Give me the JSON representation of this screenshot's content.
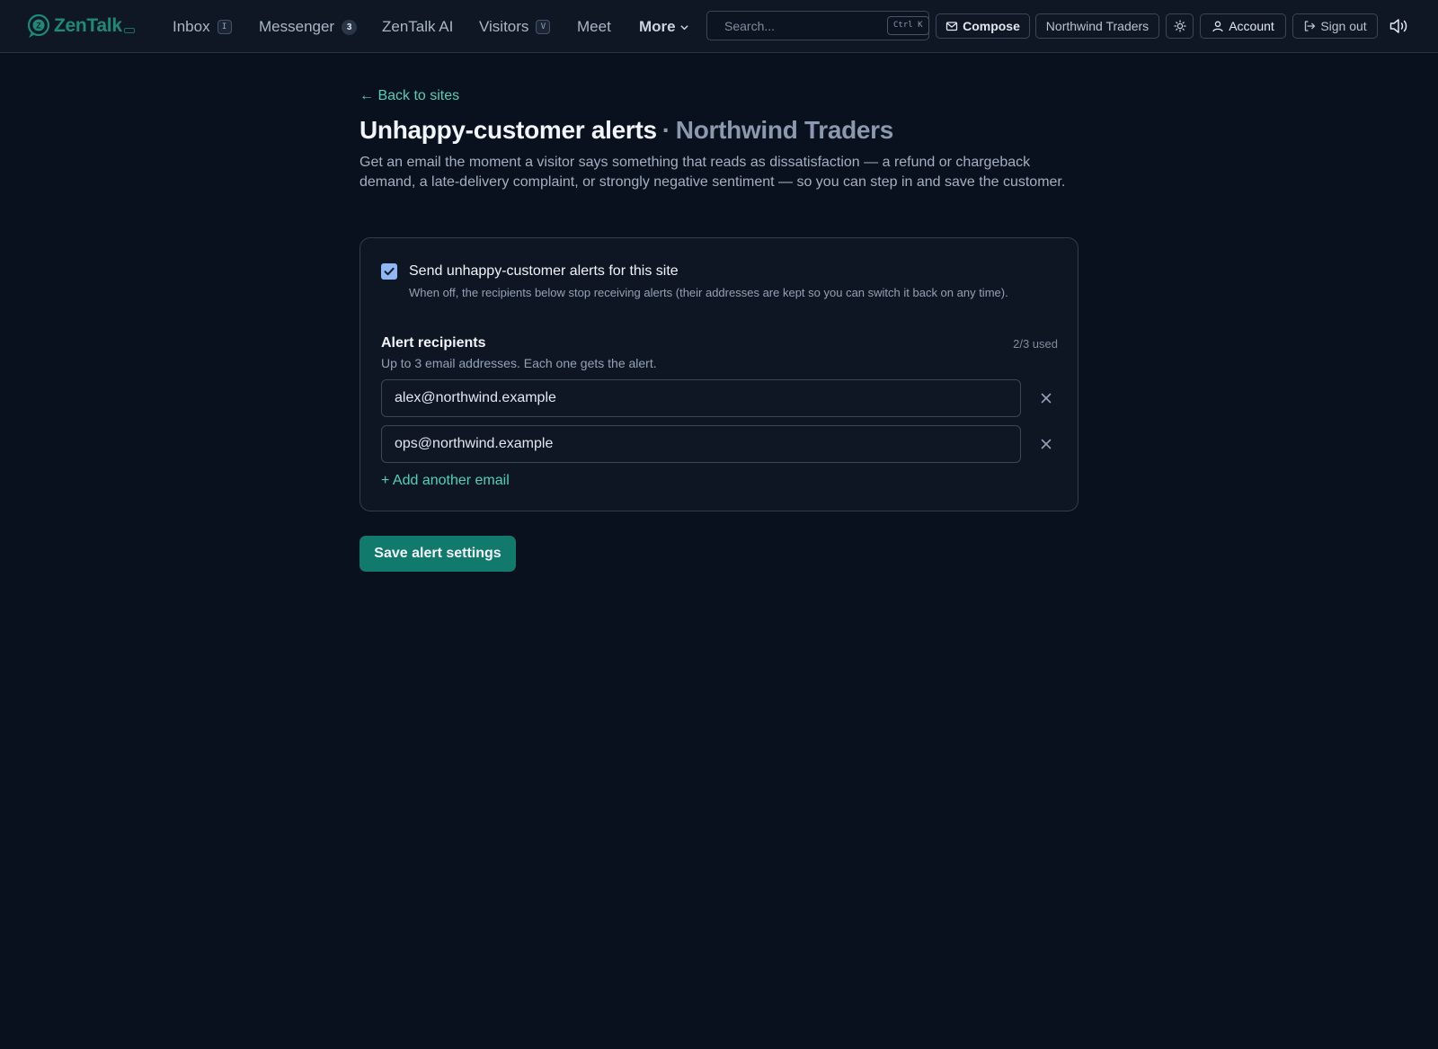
{
  "brand": {
    "name": "ZenTalk"
  },
  "nav": {
    "inbox": {
      "label": "Inbox",
      "shortcut": "I"
    },
    "messenger": {
      "label": "Messenger",
      "count": "3"
    },
    "ai": {
      "label": "ZenTalk AI"
    },
    "visitors": {
      "label": "Visitors",
      "shortcut": "V"
    },
    "meet": {
      "label": "Meet"
    },
    "more": {
      "label": "More"
    }
  },
  "search": {
    "placeholder": "Search...",
    "value": "",
    "shortcut": "Ctrl K"
  },
  "toolbar": {
    "compose_label": "Compose",
    "site_label": "Northwind Traders",
    "account_label": "Account",
    "signout_label": "Sign out"
  },
  "page": {
    "back_label": "← Back to sites",
    "title": "Unhappy-customer alerts",
    "separator": "·",
    "site_name": "Northwind Traders",
    "description": "Get an email the moment a visitor says something that reads as dissatisfaction — a refund or chargeback demand, a late-delivery complaint, or strongly negative sentiment — so you can step in and save the customer."
  },
  "settings": {
    "enabled": true,
    "enable_label": "Send unhappy-customer alerts for this site",
    "enable_help": "When off, the recipients below stop receiving alerts (their addresses are kept so you can switch it back on any time).",
    "recipients_title": "Alert recipients",
    "recipients_count": "2/3 used",
    "recipients_help": "Up to 3 email addresses. Each one gets the alert.",
    "recipients": [
      {
        "email": "alex@northwind.example"
      },
      {
        "email": "ops@northwind.example"
      }
    ],
    "add_label": "+ Add another email",
    "save_label": "Save alert settings"
  },
  "colors": {
    "background": "#0a111e",
    "accent": "#4fd1b8",
    "primary_button": "#117a6c",
    "checkbox": "#8fb7f3"
  },
  "icons": [
    "logo-icon",
    "chevron-down-icon",
    "search-icon",
    "mail-icon",
    "sun-icon",
    "user-icon",
    "sign-out-icon",
    "speaker-icon",
    "check-icon",
    "close-icon"
  ]
}
